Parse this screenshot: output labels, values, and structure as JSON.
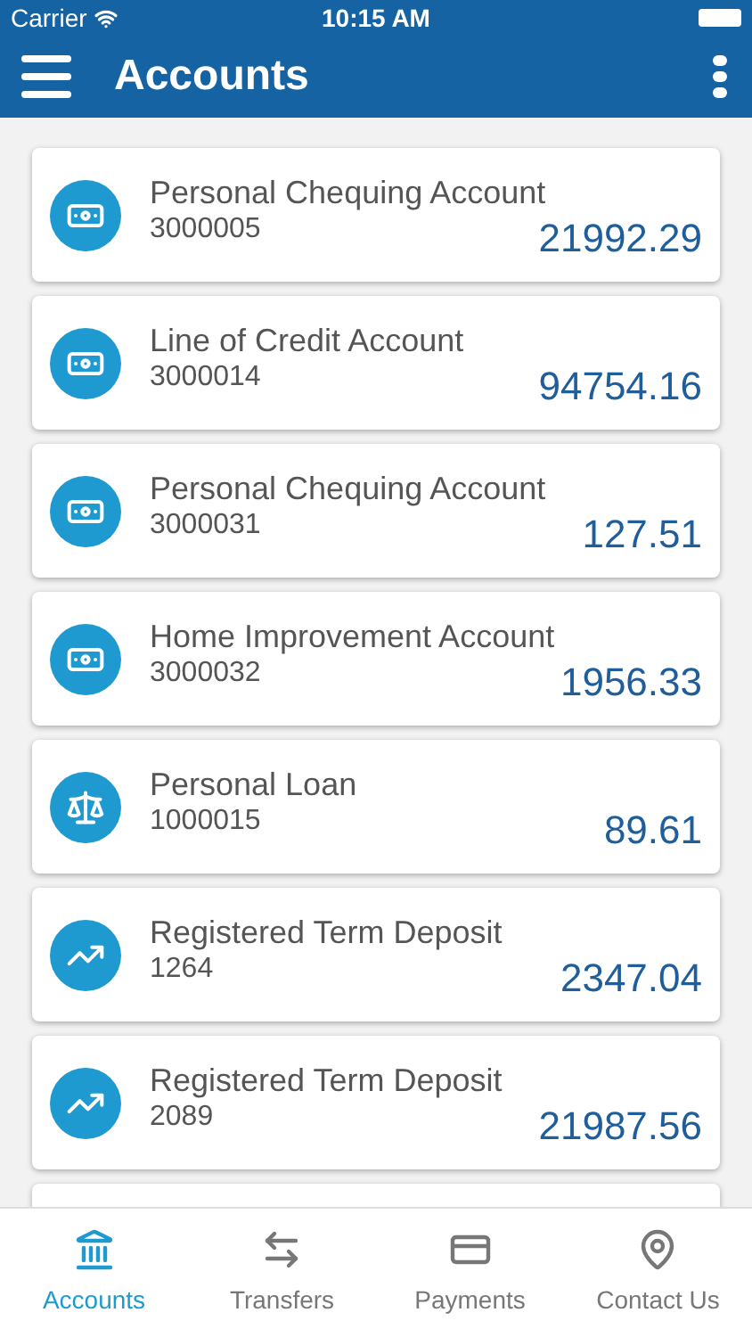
{
  "status_bar": {
    "carrier": "Carrier",
    "time": "10:15 AM"
  },
  "header": {
    "title": "Accounts"
  },
  "accounts": [
    {
      "kind": "cash",
      "name": "Personal Chequing Account",
      "number": "3000005",
      "balance": "21992.29"
    },
    {
      "kind": "cash",
      "name": "Line of Credit Account",
      "number": "3000014",
      "balance": "94754.16"
    },
    {
      "kind": "cash",
      "name": "Personal Chequing Account",
      "number": "3000031",
      "balance": "127.51"
    },
    {
      "kind": "cash",
      "name": "Home Improvement Account",
      "number": "3000032",
      "balance": "1956.33"
    },
    {
      "kind": "loan",
      "name": "Personal Loan",
      "number": "1000015",
      "balance": "89.61"
    },
    {
      "kind": "investment",
      "name": "Registered Term Deposit",
      "number": "1264",
      "balance": "2347.04"
    },
    {
      "kind": "investment",
      "name": "Registered Term Deposit",
      "number": "2089",
      "balance": "21987.56"
    }
  ],
  "tabs": [
    {
      "kind": "bank",
      "label": "Accounts",
      "selected": true
    },
    {
      "kind": "transfer",
      "label": "Transfers",
      "selected": false
    },
    {
      "kind": "card",
      "label": "Payments",
      "selected": false
    },
    {
      "kind": "pin",
      "label": "Contact Us",
      "selected": false
    }
  ]
}
